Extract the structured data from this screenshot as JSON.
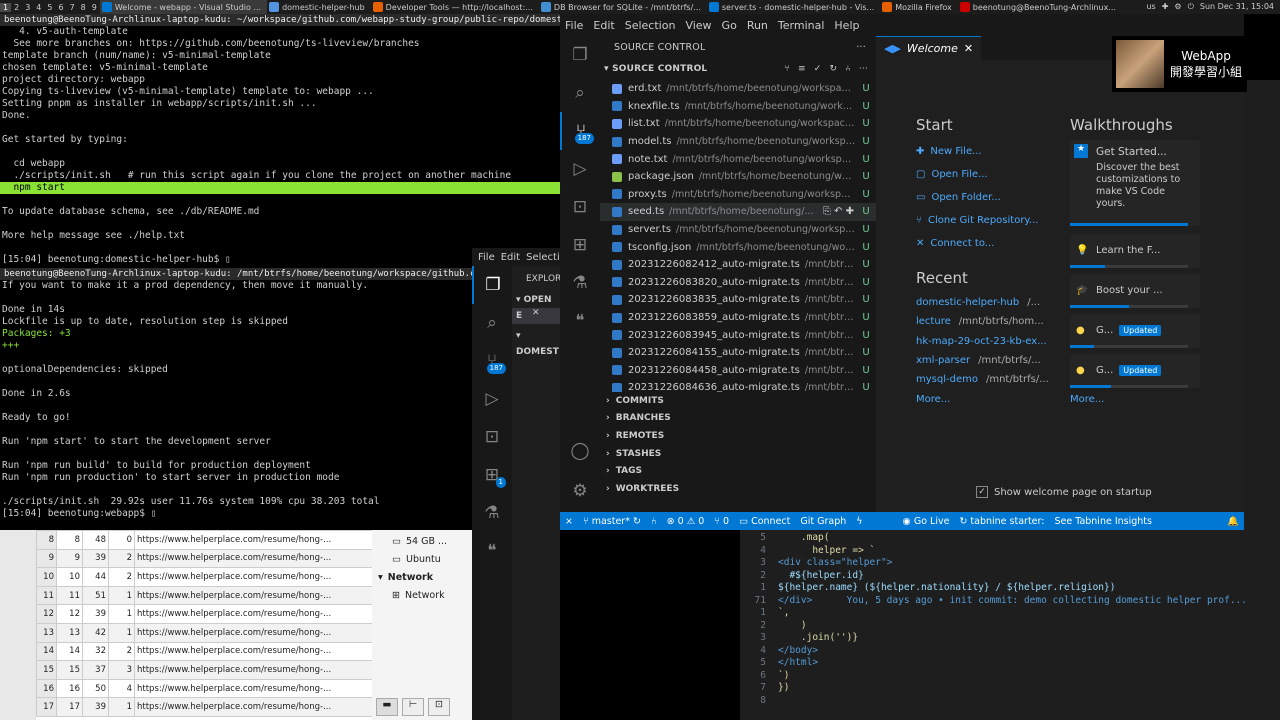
{
  "taskbar": {
    "workspaces": [
      "1",
      "2",
      "3",
      "4",
      "5",
      "6",
      "7",
      "8",
      "9"
    ],
    "tasks": [
      {
        "label": "Welcome - webapp - Visual Studio ...",
        "color": "#0078d4",
        "active": true
      },
      {
        "label": "domestic-helper-hub",
        "color": "#5294e2",
        "active": false
      },
      {
        "label": "Developer Tools — http://localhost:...",
        "color": "#e66000",
        "active": false
      },
      {
        "label": "DB Browser for SQLite - /mnt/btrfs/...",
        "color": "#3f8fd2",
        "active": false
      },
      {
        "label": "server.ts - domestic-helper-hub - Vis...",
        "color": "#0078d4",
        "active": false
      },
      {
        "label": "Mozilla Firefox",
        "color": "#e66000",
        "active": false
      },
      {
        "label": "beenotung@BeenoTung-Archlinux...",
        "color": "#c00",
        "active": false
      }
    ],
    "tray_text": "us",
    "clock": "Sun Dec 31, 15:04"
  },
  "term1": {
    "title": "beenotung@BeenoTung-Archlinux-laptop-kudu: ~/workspace/github.com/webapp-study-group/public-repo/domestic-helper-hub",
    "lines": [
      {
        "text": "   4. v5-auth-template",
        "hl": false
      },
      {
        "text": "  See more branches on: https://github.com/beenotung/ts-liveview/branches",
        "hl": false
      },
      {
        "text": "template branch (num/name): v5-minimal-template",
        "hl": false
      },
      {
        "text": "chosen template: v5-minimal-template",
        "hl": false
      },
      {
        "text": "project directory: webapp",
        "hl": false
      },
      {
        "text": "Copying ts-liveview (v5-minimal-template) template to: webapp ...",
        "hl": false
      },
      {
        "text": "Setting pnpm as installer in webapp/scripts/init.sh ...",
        "hl": false
      },
      {
        "text": "Done.",
        "hl": false
      },
      {
        "text": "",
        "hl": false
      },
      {
        "text": "Get started by typing:",
        "hl": false
      },
      {
        "text": "",
        "hl": false
      },
      {
        "text": "  cd webapp",
        "hl": false
      },
      {
        "text": "  ./scripts/init.sh   # run this script again if you clone the project on another machine",
        "hl": false
      },
      {
        "text": "  npm start",
        "hl": true
      },
      {
        "text": "",
        "hl": false
      },
      {
        "text": "To update database schema, see ./db/README.md",
        "hl": false
      },
      {
        "text": "",
        "hl": false
      },
      {
        "text": "More help message see ./help.txt",
        "hl": false
      },
      {
        "text": "",
        "hl": false
      },
      {
        "text": "[15:04] beenotung:domestic-helper-hub$ ▯",
        "hl": false
      }
    ]
  },
  "term2": {
    "title": "beenotung@BeenoTung-Archlinux-laptop-kudu: /mnt/btrfs/home/beenotung/workspace/github.com/webapp",
    "lines": [
      "If you want to make it a prod dependency, then move it manually.",
      "",
      "Done in 14s",
      "Lockfile is up to date, resolution step is skipped",
      "Packages: +3",
      "+++",
      "",
      "optionalDependencies: skipped",
      "",
      "Done in 2.6s",
      "",
      "Ready to go!",
      "",
      "Run 'npm start' to start the development server",
      "",
      "Run 'npm run build' to build for production deployment",
      "Run 'npm run production' to start server in production mode",
      "",
      "./scripts/init.sh  29.92s user 11.76s system 109% cpu 38.203 total",
      "[15:04] beenotung:webapp$ ▯"
    ]
  },
  "db_table": {
    "rows": [
      [
        "8",
        "8",
        "48",
        "0",
        "https://www.helperplace.com/resume/hong-..."
      ],
      [
        "9",
        "9",
        "39",
        "2",
        "https://www.helperplace.com/resume/hong-..."
      ],
      [
        "10",
        "10",
        "44",
        "2",
        "https://www.helperplace.com/resume/hong-..."
      ],
      [
        "11",
        "11",
        "51",
        "1",
        "https://www.helperplace.com/resume/hong-..."
      ],
      [
        "12",
        "12",
        "39",
        "1",
        "https://www.helperplace.com/resume/hong-..."
      ],
      [
        "13",
        "13",
        "42",
        "1",
        "https://www.helperplace.com/resume/hong-..."
      ],
      [
        "14",
        "14",
        "32",
        "2",
        "https://www.helperplace.com/resume/hong-..."
      ],
      [
        "15",
        "15",
        "37",
        "3",
        "https://www.helperplace.com/resume/hong-..."
      ],
      [
        "16",
        "16",
        "50",
        "4",
        "https://www.helperplace.com/resume/hong-..."
      ],
      [
        "17",
        "17",
        "39",
        "1",
        "https://www.helperplace.com/resume/hong-..."
      ]
    ]
  },
  "side_panel": {
    "disk": "54 GB ...",
    "ubuntu": "Ubuntu",
    "network_header": "Network",
    "network_item": "Network"
  },
  "vs2": {
    "menu": [
      "File",
      "Edit",
      "Selectio"
    ],
    "explorer": "EXPLOR",
    "open_editors": "OPEN E",
    "folder": "DOMEST",
    "badge": "187",
    "badge2": "1"
  },
  "vscode": {
    "menu": [
      "File",
      "Edit",
      "Selection",
      "View",
      "Go",
      "Run",
      "Terminal",
      "Help"
    ],
    "scm_badge": "187",
    "panel_title": "SOURCE CONTROL",
    "section_title": "SOURCE CONTROL",
    "files": [
      {
        "name": "erd.txt",
        "path": "/mnt/btrfs/home/beenotung/workspace/gi...",
        "status": "U",
        "icon": "#6c9ef8"
      },
      {
        "name": "knexfile.ts",
        "path": "/mnt/btrfs/home/beenotung/workspac...",
        "status": "U",
        "icon": "#3178c6"
      },
      {
        "name": "list.txt",
        "path": "/mnt/btrfs/home/beenotung/workspace/gi...",
        "status": "U",
        "icon": "#6c9ef8"
      },
      {
        "name": "model.ts",
        "path": "/mnt/btrfs/home/beenotung/workspace/...",
        "status": "U",
        "icon": "#3178c6"
      },
      {
        "name": "note.txt",
        "path": "/mnt/btrfs/home/beenotung/workspace/...",
        "status": "U",
        "icon": "#6c9ef8"
      },
      {
        "name": "package.json",
        "path": "/mnt/btrfs/home/beenotung/works...",
        "status": "U",
        "icon": "#8bc34a"
      },
      {
        "name": "proxy.ts",
        "path": "/mnt/btrfs/home/beenotung/workspace/...",
        "status": "U",
        "icon": "#3178c6"
      },
      {
        "name": "seed.ts",
        "path": "/mnt/btrfs/home/beenotung/...",
        "status": "U",
        "icon": "#3178c6"
      },
      {
        "name": "server.ts",
        "path": "/mnt/btrfs/home/beenotung/workspace/...",
        "status": "U",
        "icon": "#3178c6"
      },
      {
        "name": "tsconfig.json",
        "path": "/mnt/btrfs/home/beenotung/works...",
        "status": "U",
        "icon": "#3178c6"
      },
      {
        "name": "20231226082412_auto-migrate.ts",
        "path": "/mnt/btrfs/h...",
        "status": "U",
        "icon": "#3178c6"
      },
      {
        "name": "20231226083820_auto-migrate.ts",
        "path": "/mnt/btrfs/...",
        "status": "U",
        "icon": "#3178c6"
      },
      {
        "name": "20231226083835_auto-migrate.ts",
        "path": "/mnt/btrfs/...",
        "status": "U",
        "icon": "#3178c6"
      },
      {
        "name": "20231226083859_auto-migrate.ts",
        "path": "/mnt/btrfs/...",
        "status": "U",
        "icon": "#3178c6"
      },
      {
        "name": "20231226083945_auto-migrate.ts",
        "path": "/mnt/btrfs/...",
        "status": "U",
        "icon": "#3178c6"
      },
      {
        "name": "20231226084155_auto-migrate.ts",
        "path": "/mnt/btrfs/h...",
        "status": "U",
        "icon": "#3178c6"
      },
      {
        "name": "20231226084458_auto-migrate.ts",
        "path": "/mnt/btrfs/...",
        "status": "U",
        "icon": "#3178c6"
      },
      {
        "name": "20231226084636_auto-migrate.ts",
        "path": "/mnt/btrfs/...",
        "status": "U",
        "icon": "#3178c6"
      }
    ],
    "sections": [
      "COMMITS",
      "BRANCHES",
      "REMOTES",
      "STASHES",
      "TAGS",
      "WORKTREES"
    ],
    "tab_label": "Welcome",
    "start_title": "Start",
    "start_links": [
      {
        "icon": "✚",
        "label": "New File..."
      },
      {
        "icon": "▢",
        "label": "Open File..."
      },
      {
        "icon": "▭",
        "label": "Open Folder..."
      },
      {
        "icon": "⑂",
        "label": "Clone Git Repository..."
      },
      {
        "icon": "✕",
        "label": "Connect to..."
      }
    ],
    "recent_title": "Recent",
    "recent": [
      {
        "name": "domestic-helper-hub",
        "path": "/..."
      },
      {
        "name": "lecture",
        "path": "/mnt/btrfs/hom..."
      },
      {
        "name": "hk-map-29-oct-23-kb-ex...",
        "path": ""
      },
      {
        "name": "xml-parser",
        "path": "/mnt/btrfs/..."
      },
      {
        "name": "mysql-demo",
        "path": "/mnt/btrfs/..."
      }
    ],
    "recent_more": "More...",
    "walk_title": "Walkthroughs",
    "walk_featured_title": "Get Started...",
    "walk_featured_desc": "Discover the best customizations to make VS Code yours.",
    "walks": [
      {
        "label": "Learn the F...",
        "icon": "💡",
        "updated": "",
        "progress": 0.3
      },
      {
        "label": "Boost your ...",
        "icon": "🎓",
        "updated": "",
        "progress": 0.5
      },
      {
        "label": "G...",
        "icon": "●",
        "updated": "Updated",
        "progress": 0.2
      },
      {
        "label": "G...",
        "icon": "●",
        "updated": "Updated",
        "progress": 0.35
      }
    ],
    "walk_more": "More...",
    "show_welcome": "Show welcome page on startup",
    "status": {
      "branch": "master*",
      "errors": "0",
      "warnings": "0",
      "infos": "0",
      "connect": "Connect",
      "git_graph": "Git Graph",
      "go_live": "Go Live",
      "tabnine": "tabnine starter:",
      "tabnine_link": "See Tabnine Insights"
    }
  },
  "overlay": {
    "line1": "WebApp",
    "line2": "開發學習小組"
  },
  "code": {
    "lines": [
      {
        "n": "5",
        "t": "    .map("
      },
      {
        "n": "4",
        "t": "      helper => `"
      },
      {
        "n": "3",
        "t": "<div class=\"helper\">"
      },
      {
        "n": "2",
        "t": "  #${helper.id}"
      },
      {
        "n": "1",
        "t": "${helper.name} (${helper.nationality} / ${helper.religion})"
      },
      {
        "n": "71",
        "t": "</div>      You, 5 days ago • init commit: demo collecting domestic helper prof..."
      },
      {
        "n": "1",
        "t": "`,"
      },
      {
        "n": "2",
        "t": "    )"
      },
      {
        "n": "3",
        "t": "    .join('')}"
      },
      {
        "n": "4",
        "t": "</body>"
      },
      {
        "n": "5",
        "t": "</html>"
      },
      {
        "n": "6",
        "t": "`)"
      },
      {
        "n": "7",
        "t": "})"
      },
      {
        "n": "8",
        "t": ""
      }
    ]
  }
}
